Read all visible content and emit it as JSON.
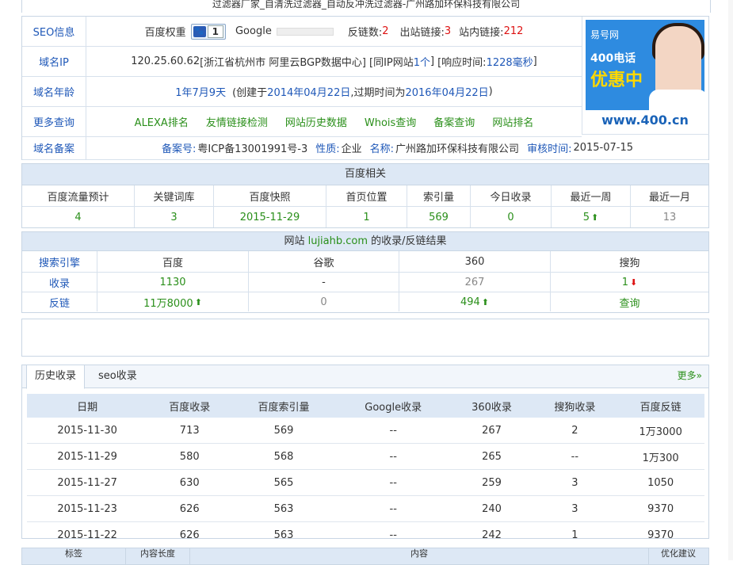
{
  "page_title": "过滤器厂家_自清洗过滤器_自动反冲洗过滤器-广州路加环保科技有限公司",
  "info": {
    "seo": {
      "label": "SEO信息",
      "baidu_weight_label": "百度权重",
      "baidu_weight_value": "1",
      "google_label": "Google",
      "backlinks_label": "反链数:",
      "backlinks_value": "2",
      "outbound_label": "出站链接:",
      "outbound_value": "3",
      "internal_label": "站内链接:",
      "internal_value": "212"
    },
    "ip": {
      "label": "域名IP",
      "ip": "120.25.60.62",
      "location": "[浙江省杭州市 阿里云BGP数据中心]",
      "same_ip_prefix": "[同IP网站",
      "same_ip_count": "1个",
      "same_ip_suffix": "]",
      "response_prefix": "[响应时间:",
      "response_value": "1228毫秒",
      "response_suffix": "]"
    },
    "age": {
      "label": "域名年龄",
      "age_value": "1年7月9天",
      "created_prefix": "(创建于",
      "created_date": "2014年04月22日",
      "expire_prefix": ",过期时间为",
      "expire_date": "2016年04月22日",
      "close": ")"
    },
    "more": {
      "label": "更多查询",
      "links": [
        "ALEXA排名",
        "友情链接检测",
        "网站历史数据",
        "Whois查询",
        "备案查询",
        "网站排名"
      ]
    },
    "beian": {
      "label": "域名备案",
      "no_label": "备案号:",
      "no_value": "粤ICP备13001991号-3",
      "nature_label": "性质:",
      "nature_value": "企业",
      "name_label": "名称:",
      "name_value": "广州路加环保科技有限公司",
      "audit_label": "审核时间:",
      "audit_value": "2015-07-15"
    },
    "ad": {
      "brand": "易号网",
      "line1": "400电话",
      "line2": "优惠中",
      "url": "www.400.cn"
    }
  },
  "baidu": {
    "title": "百度相关",
    "headers": [
      "百度流量预计",
      "关键词库",
      "百度快照",
      "首页位置",
      "索引量",
      "今日收录",
      "最近一周",
      "最近一月"
    ],
    "values": [
      "4",
      "3",
      "2015-11-29",
      "1",
      "569",
      "0",
      "5",
      "13"
    ]
  },
  "index": {
    "title_prefix": "网站",
    "domain": "lujiahb.com",
    "title_suffix": "的收录/反链结果",
    "headers": [
      "搜索引擎",
      "百度",
      "谷歌",
      "360",
      "搜狗"
    ],
    "row1_label": "收录",
    "row1": [
      "1130",
      "-",
      "267",
      "1"
    ],
    "row2_label": "反链",
    "row2": [
      "11万8000",
      "0",
      "494",
      "查询"
    ]
  },
  "history": {
    "tabs": [
      "历史收录",
      "seo收录"
    ],
    "more": "更多»",
    "headers": [
      "日期",
      "百度收录",
      "百度索引量",
      "Google收录",
      "360收录",
      "搜狗收录",
      "百度反链"
    ],
    "rows": [
      [
        "2015-11-30",
        "713",
        "569",
        "--",
        "267",
        "2",
        "1万3000"
      ],
      [
        "2015-11-29",
        "580",
        "568",
        "--",
        "265",
        "--",
        "1万300"
      ],
      [
        "2015-11-27",
        "630",
        "565",
        "--",
        "259",
        "3",
        "1050"
      ],
      [
        "2015-11-23",
        "626",
        "563",
        "--",
        "240",
        "3",
        "9370"
      ],
      [
        "2015-11-22",
        "626",
        "563",
        "--",
        "242",
        "1",
        "9370"
      ]
    ]
  },
  "bottom_strip": [
    "标签",
    "内容长度",
    "内容",
    "优化建议"
  ]
}
